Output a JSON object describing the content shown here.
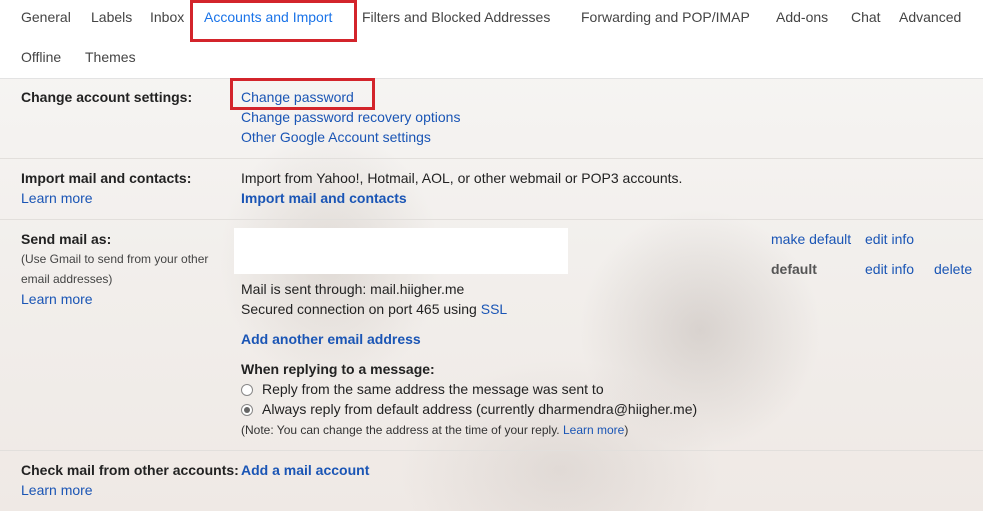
{
  "tabs": {
    "items": [
      {
        "label": "General"
      },
      {
        "label": "Labels"
      },
      {
        "label": "Inbox"
      },
      {
        "label": "Accounts and Import"
      },
      {
        "label": "Filters and Blocked Addresses"
      },
      {
        "label": "Forwarding and POP/IMAP"
      },
      {
        "label": "Add-ons"
      },
      {
        "label": "Chat"
      },
      {
        "label": "Advanced"
      },
      {
        "label": "Offline"
      },
      {
        "label": "Themes"
      }
    ],
    "active": "Accounts and Import"
  },
  "change_account": {
    "label": "Change account settings:",
    "links": [
      "Change password",
      "Change password recovery options",
      "Other Google Account settings"
    ]
  },
  "import_mail": {
    "label": "Import mail and contacts:",
    "learn_more": "Learn more",
    "description": "Import from Yahoo!, Hotmail, AOL, or other webmail or POP3 accounts.",
    "action": "Import mail and contacts"
  },
  "send_mail": {
    "label": "Send mail as:",
    "sublabel_1": "(Use Gmail to send from your other",
    "sublabel_2": "email addresses)",
    "learn_more": "Learn more",
    "row1_actions": {
      "make_default": "make default",
      "edit_info": "edit info"
    },
    "row2_actions": {
      "default": "default",
      "edit_info": "edit info",
      "delete": "delete"
    },
    "sent_through": "Mail is sent through: mail.hiigher.me",
    "secured_prefix": "Secured connection on port 465 using ",
    "secured_link": "SSL",
    "add_address": "Add another email address",
    "reply_heading": "When replying to a message:",
    "reply_options": [
      "Reply from the same address the message was sent to",
      "Always reply from default address (currently dharmendra@hiigher.me)"
    ],
    "note_prefix": "(Note: You can change the address at the time of your reply. ",
    "note_link": "Learn more",
    "note_suffix": ")"
  },
  "check_mail": {
    "label": "Check mail from other accounts:",
    "action": "Add a mail account",
    "learn_more": "Learn more"
  },
  "colors": {
    "accent": "#1a73e8",
    "link": "#1a55b5",
    "highlight": "#d3242b"
  }
}
